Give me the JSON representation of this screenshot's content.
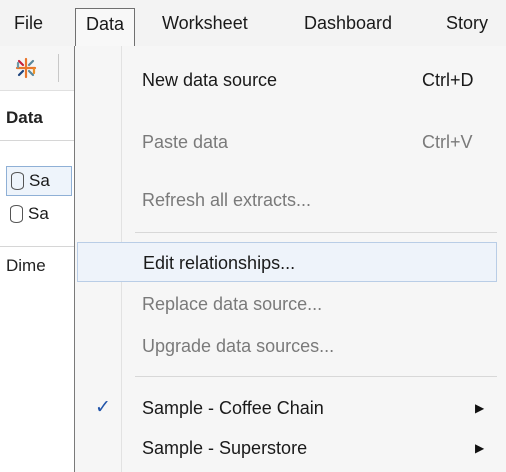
{
  "menubar": {
    "items": [
      "File",
      "Data",
      "Worksheet",
      "Dashboard",
      "Story"
    ]
  },
  "left_pane": {
    "title": "Data",
    "sources": [
      "Sa",
      "Sa"
    ],
    "dimensions_label": "Dime"
  },
  "data_menu": {
    "items": [
      {
        "label": "New data source",
        "shortcut": "Ctrl+D",
        "enabled": true
      },
      {
        "label": "Paste data",
        "shortcut": "Ctrl+V",
        "enabled": false
      },
      {
        "label": "Refresh all extracts...",
        "enabled": false
      },
      {
        "label": "Edit relationships...",
        "enabled": true,
        "highlighted": true
      },
      {
        "label": "Replace data source...",
        "enabled": false
      },
      {
        "label": "Upgrade data sources...",
        "enabled": false
      },
      {
        "label": "Sample - Coffee Chain",
        "enabled": true,
        "checked": true,
        "submenu": true,
        "check_mark": "✓",
        "arrow": "▶"
      },
      {
        "label": "Sample - Superstore",
        "enabled": true,
        "submenu": true,
        "arrow": "▶"
      }
    ]
  },
  "colors": {
    "menu_bg": "#f6f6f6",
    "highlight_bg": "#eef3fa",
    "highlight_border": "#b9cde6",
    "check": "#2255aa",
    "disabled_text": "#7a7a7a"
  }
}
